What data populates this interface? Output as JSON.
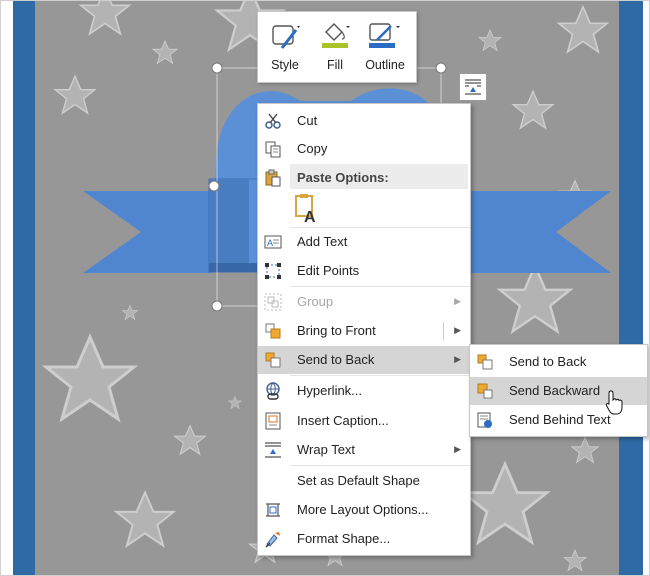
{
  "mini_toolbar": {
    "style_label": "Style",
    "fill_label": "Fill",
    "outline_label": "Outline",
    "fill_color": "#a8c428",
    "outline_color": "#2b6cc4"
  },
  "layout_options_icon": "layout-options-icon",
  "context_menu": {
    "cut": "Cut",
    "copy": "Copy",
    "paste_options": "Paste Options:",
    "add_text": "Add Text",
    "edit_points": "Edit Points",
    "group": "Group",
    "bring_to_front": "Bring to Front",
    "send_to_back": "Send to Back",
    "hyperlink": "Hyperlink...",
    "insert_caption": "Insert Caption...",
    "wrap_text": "Wrap Text",
    "set_default_shape": "Set as Default Shape",
    "more_layout_options": "More Layout Options...",
    "format_shape": "Format Shape..."
  },
  "submenu": {
    "send_to_back": "Send to Back",
    "send_backward": "Send Backward",
    "send_behind_text": "Send Behind Text"
  },
  "colors": {
    "page_border": "#2f6aa6",
    "page_bg": "#979797",
    "shape_blue": "#5b8fd6",
    "menu_highlight": "#d5d5d5"
  }
}
